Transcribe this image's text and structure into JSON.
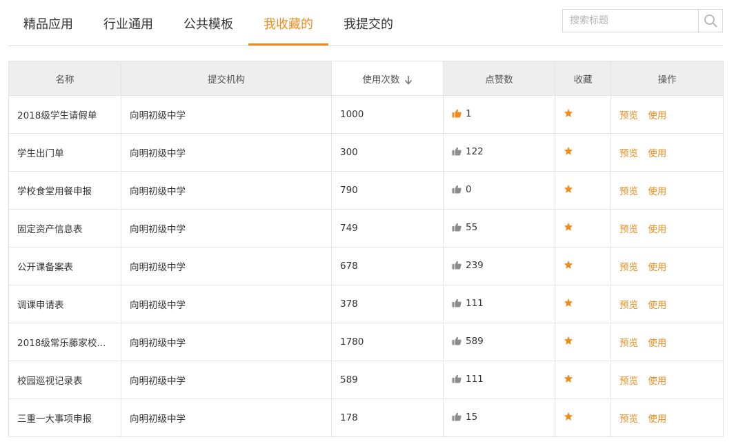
{
  "tabs": [
    {
      "label": "精品应用",
      "active": false
    },
    {
      "label": "行业通用",
      "active": false
    },
    {
      "label": "公共模板",
      "active": false
    },
    {
      "label": "我收藏的",
      "active": true
    },
    {
      "label": "我提交的",
      "active": false
    }
  ],
  "search": {
    "placeholder": "搜索标题",
    "icon": "search-icon"
  },
  "colors": {
    "accent": "#f08c1e",
    "like_inactive": "#8c8c8c"
  },
  "table": {
    "columns": [
      "名称",
      "提交机构",
      "使用次数",
      "点赞数",
      "收藏",
      "操作"
    ],
    "sort": {
      "column": "使用次数",
      "direction": "down"
    },
    "rows": [
      {
        "name": "2018级学生请假单",
        "org": "向明初级中学",
        "uses": "1000",
        "likes": "1",
        "liked": true,
        "favorited": true,
        "preview": "预览",
        "use": "使用"
      },
      {
        "name": "学生出门单",
        "org": "向明初级中学",
        "uses": "300",
        "likes": "122",
        "liked": false,
        "favorited": true,
        "preview": "预览",
        "use": "使用"
      },
      {
        "name": "学校食堂用餐申报",
        "org": "向明初级中学",
        "uses": "790",
        "likes": "0",
        "liked": false,
        "favorited": true,
        "preview": "预览",
        "use": "使用"
      },
      {
        "name": "固定资产信息表",
        "org": "向明初级中学",
        "uses": "749",
        "likes": "55",
        "liked": false,
        "favorited": true,
        "preview": "预览",
        "use": "使用"
      },
      {
        "name": "公开课备案表",
        "org": "向明初级中学",
        "uses": "678",
        "likes": "239",
        "liked": false,
        "favorited": true,
        "preview": "预览",
        "use": "使用"
      },
      {
        "name": "调课申请表",
        "org": "向明初级中学",
        "uses": "378",
        "likes": "111",
        "liked": false,
        "favorited": true,
        "preview": "预览",
        "use": "使用"
      },
      {
        "name": "2018级常乐藤家校...",
        "org": "向明初级中学",
        "uses": "1780",
        "likes": "589",
        "liked": false,
        "favorited": true,
        "preview": "预览",
        "use": "使用"
      },
      {
        "name": "校园巡视记录表",
        "org": "向明初级中学",
        "uses": "589",
        "likes": "111",
        "liked": false,
        "favorited": true,
        "preview": "预览",
        "use": "使用"
      },
      {
        "name": "三重一大事项申报",
        "org": "向明初级中学",
        "uses": "178",
        "likes": "15",
        "liked": false,
        "favorited": true,
        "preview": "预览",
        "use": "使用"
      }
    ]
  }
}
